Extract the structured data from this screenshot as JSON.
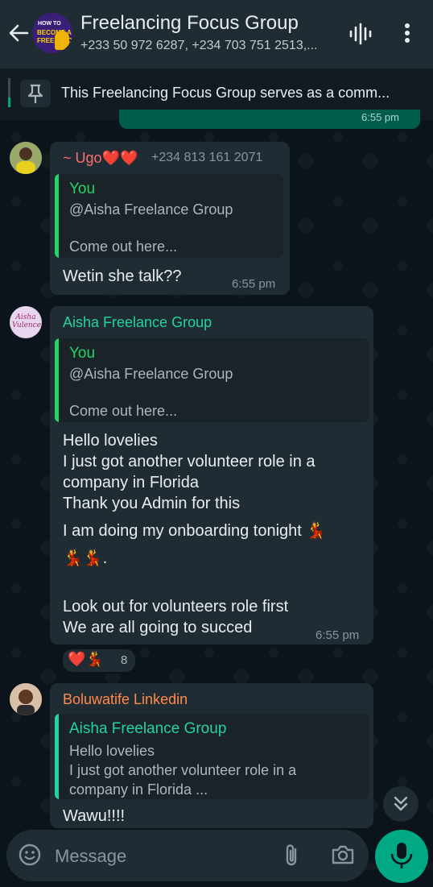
{
  "header": {
    "title": "Freelancing Focus Group",
    "subtitle": "+233 50 972 6287, +234 703 751 2513,...",
    "avatar_text": [
      "HOW TO",
      "BECOME A",
      "FREELANCER"
    ]
  },
  "pinned": {
    "text": "This Freelancing Focus Group serves as a comm..."
  },
  "previous_message": {
    "time": "6:55 pm"
  },
  "messages": [
    {
      "sender": "~ Ugo❤️❤️",
      "phone": "+234 813 161 2071",
      "quote": {
        "author": "You",
        "lines": [
          "@Aisha Freelance Group",
          "",
          "Come out here..."
        ]
      },
      "text": [
        "Wetin she talk??"
      ],
      "time": "6:55 pm"
    },
    {
      "sender": "Aisha Freelance Group",
      "avatar_text": "Aisha Vulences",
      "quote": {
        "author": "You",
        "lines": [
          "@Aisha Freelance Group",
          "",
          "Come out here..."
        ]
      },
      "text": [
        "Hello lovelies",
        "I just got another volunteer role in a",
        "company in Florida",
        "Thank you Admin for this",
        "I am doing my onboarding tonight 💃",
        "💃💃.",
        "",
        "Look out for volunteers role first",
        "We are all going to succed"
      ],
      "time": "6:55 pm",
      "reactions": {
        "emojis": "❤️💃",
        "count": "8"
      }
    },
    {
      "sender": "Boluwatife Linkedin",
      "quote": {
        "author": "Aisha Freelance Group",
        "lines": [
          "Hello lovelies",
          "I just got another volunteer role in a",
          "company in Florida ..."
        ]
      },
      "text": [
        "Wawu!!!!"
      ]
    }
  ],
  "composer": {
    "placeholder": "Message"
  },
  "colors": {
    "header_bg": "#1f2c34",
    "bubble_in": "#202c33",
    "bubble_out": "#005c4b",
    "accent": "#00a884",
    "ugo_name": "#ff6e6e",
    "aisha_name": "#25d3a0",
    "bolu_name": "#ff8a4c"
  },
  "icons": [
    "back-arrow-icon",
    "voice-wave-icon",
    "more-vert-icon",
    "pin-icon",
    "emoji-icon",
    "attach-icon",
    "camera-icon",
    "mic-icon",
    "double-chevron-down-icon"
  ]
}
